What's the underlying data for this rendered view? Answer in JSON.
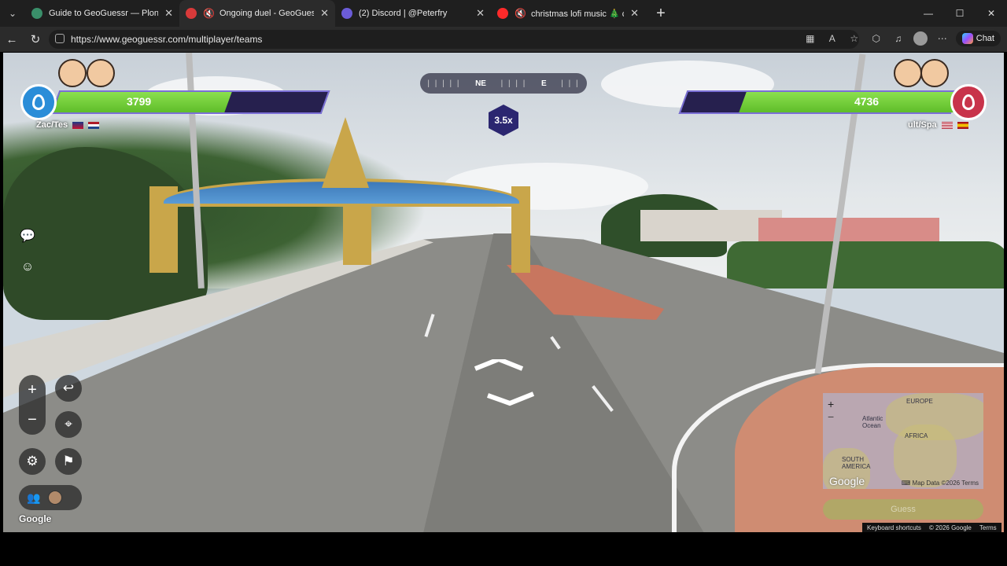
{
  "browser": {
    "tabs": [
      {
        "title": "Guide to GeoGuessr — Plonk It",
        "icon_color": "#3a8f6a",
        "active": false,
        "speaker": false
      },
      {
        "title": "Ongoing duel - GeoGuessr",
        "icon_color": "#d83a3a",
        "active": true,
        "speaker": true
      },
      {
        "title": "(2) Discord | @Peterfry",
        "icon_color": "#6b5cd8",
        "active": false,
        "speaker": false
      },
      {
        "title": "christmas lofi music 🎄 cozy ra",
        "icon_color": "#ff2a2a",
        "active": false,
        "speaker": true
      }
    ],
    "new_tab_label": "+",
    "url": "https://www.geoguessr.com/multiplayer/teams",
    "chat_label": "Chat"
  },
  "game": {
    "left_team": {
      "score": "3799",
      "name": "Zac/Tes",
      "fill_fraction": 0.64,
      "color": "#2a8dd8"
    },
    "right_team": {
      "score": "4736",
      "name": "ult/Spa",
      "fill_fraction": 0.8,
      "color": "#c8334a"
    },
    "compass": {
      "left_ticks": "|  |  |  |  |",
      "primary": "NE",
      "mid_ticks": "|  |  |  |",
      "secondary": "E",
      "right_ticks": "|  |  |"
    },
    "multiplier": "3.5x",
    "zoom_in": "+",
    "zoom_out": "−",
    "google_label": "Google",
    "minimap": {
      "labels": {
        "europe": "EUROPE",
        "atlantic": "Atlantic Ocean",
        "africa": "AFRICA",
        "south_america": "SOUTH AMERICA"
      },
      "google": "Google",
      "map_data": "Map Data ©2026",
      "terms": "Terms"
    },
    "guess_label": "Guess",
    "footer": {
      "shortcuts": "Keyboard shortcuts",
      "copyright": "© 2026 Google",
      "terms": "Terms"
    }
  }
}
